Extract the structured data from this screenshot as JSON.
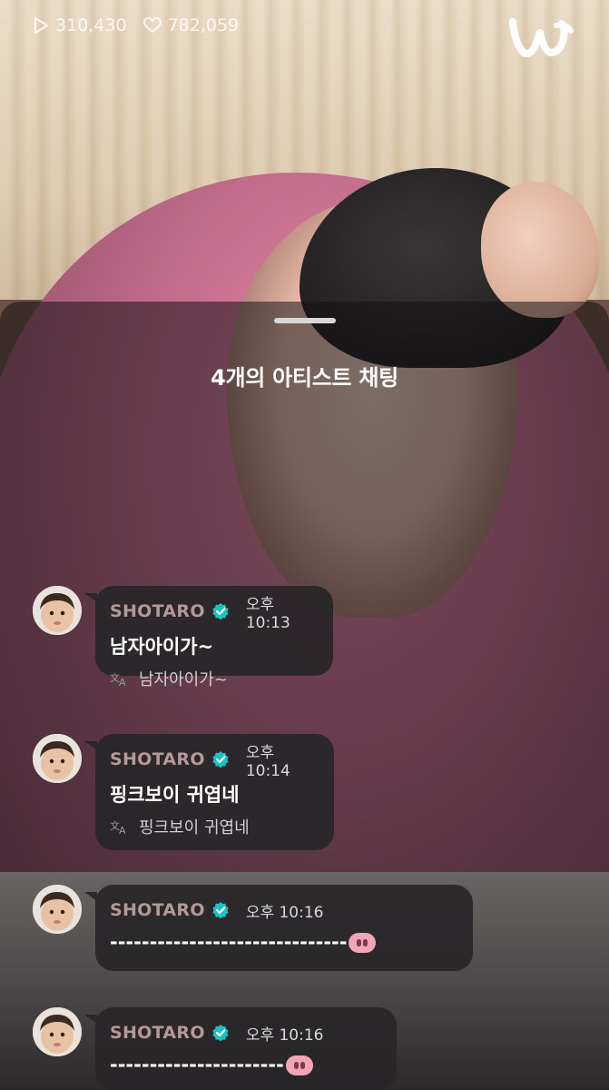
{
  "stats": {
    "views": "310,430",
    "likes": "782,059"
  },
  "app": {
    "logo_icon": "weverse-w-logo"
  },
  "sheet": {
    "title": "4개의 아티스트 채팅"
  },
  "messages": [
    {
      "name": "SHOTARO",
      "time": "오후 10:13",
      "text": "남자아이가~",
      "translation": "남자아이가~"
    },
    {
      "name": "SHOTARO",
      "time": "오후 10:14",
      "text": "핑크보이 귀엽네",
      "translation": "핑크보이 귀엽네"
    },
    {
      "name": "SHOTARO",
      "time": "오후 10:16",
      "text": "------------------------------",
      "emoji": "pig-nose-emoji"
    },
    {
      "name": "SHOTARO",
      "time": "오후 10:16",
      "text": "----------------------",
      "emoji": "pig-nose-emoji"
    }
  ],
  "colors": {
    "name": "#b59999",
    "verified": "#17c3c3",
    "sheet": "rgba(18,16,18,0.52)"
  }
}
